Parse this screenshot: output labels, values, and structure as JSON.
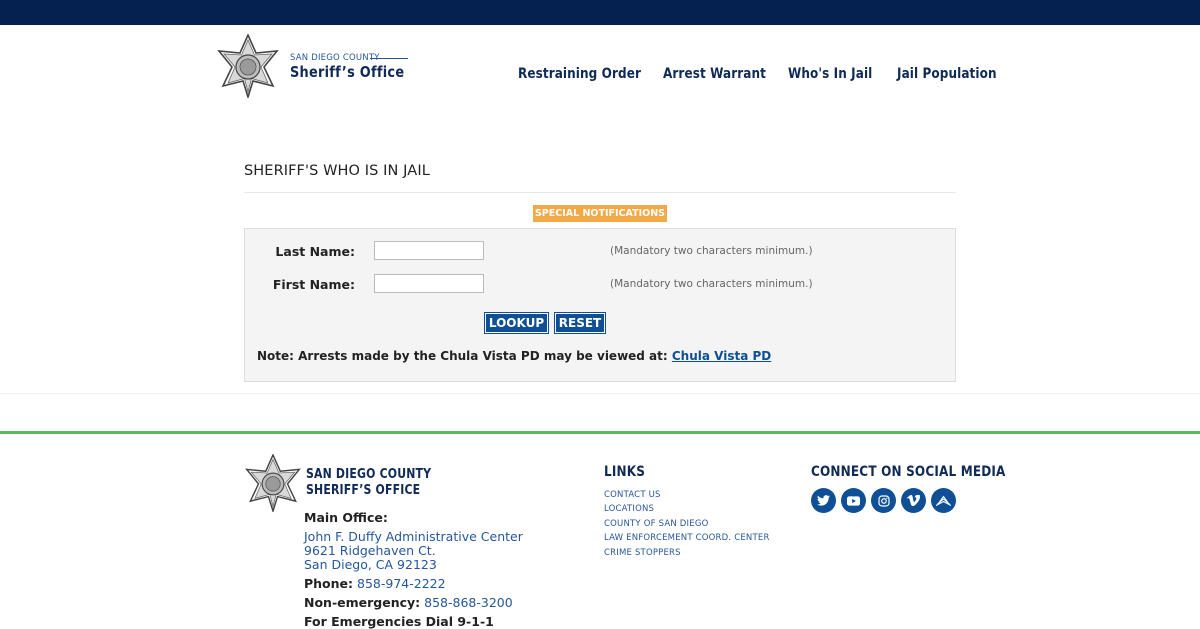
{
  "header": {
    "county": "SAN DIEGO COUNTY",
    "office": "Sheriff’s Office"
  },
  "nav": {
    "items": [
      {
        "label": "Restraining Order"
      },
      {
        "label": "Arrest Warrant"
      },
      {
        "label": "Who's In Jail"
      },
      {
        "label": "Jail Population"
      }
    ]
  },
  "main": {
    "title": "SHERIFF'S WHO IS IN JAIL",
    "special_notifications": "SPECIAL NOTIFICATIONS",
    "form": {
      "last_name_label": "Last Name:",
      "last_name_value": "",
      "first_name_label": "First Name:",
      "first_name_value": "",
      "hint": "(Mandatory two characters minimum.)",
      "lookup_label": "LOOKUP",
      "reset_label": "RESET",
      "note_text": "Note: Arrests made by the Chula Vista PD may be viewed at: ",
      "note_link": "Chula Vista PD"
    }
  },
  "footer": {
    "logo_line1": "SAN DIEGO COUNTY",
    "logo_line2": "SHERIFF’S OFFICE",
    "main_office_label": "Main Office:",
    "address_line1": "John F. Duffy Administrative Center",
    "address_line2": "9621 Ridgehaven Ct.",
    "address_line3": "San Diego, CA 92123",
    "phone_label": "Phone:",
    "phone": "858-974-2222",
    "nonemergency_label": "Non-emergency:",
    "nonemergency": "858-868-3200",
    "emergency_text": "For Emergencies Dial 9-1-1",
    "links_heading": "LINKS",
    "links": [
      {
        "label": "CONTACT US"
      },
      {
        "label": "LOCATIONS"
      },
      {
        "label": "COUNTY OF SAN DIEGO"
      },
      {
        "label": "LAW ENFORCEMENT COORD. CENTER"
      },
      {
        "label": "CRIME STOPPERS"
      }
    ],
    "social_heading": "CONNECT ON SOCIAL MEDIA",
    "social_icons": [
      "twitter-icon",
      "youtube-icon",
      "instagram-icon",
      "vimeo-icon",
      "nixle-icon"
    ]
  },
  "colors": {
    "topbar": "#04214f",
    "brand_blue": "#0e4f96",
    "navy_text": "#0f2a57",
    "link_blue": "#26579b",
    "notification_orange": "#f2a947",
    "footer_green": "#5cb85c"
  }
}
